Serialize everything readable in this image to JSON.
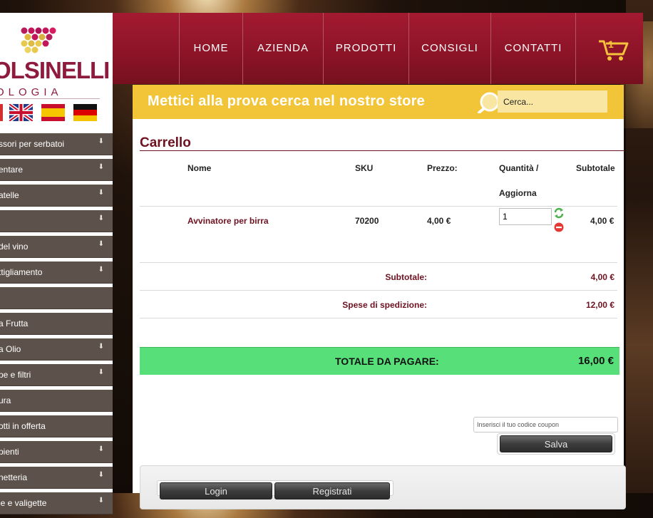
{
  "brand": {
    "name": "OLSINELLI",
    "subtitle": "OLOGIA"
  },
  "languages": [
    "Italiano",
    "English",
    "Español",
    "Deutsch"
  ],
  "sidebar": {
    "items": [
      {
        "label": "ssori per serbatoi",
        "has_children": true
      },
      {
        "label": "entare",
        "has_children": true
      },
      {
        "label": "atelle",
        "has_children": true
      },
      {
        "label": "",
        "has_children": true
      },
      {
        "label": "del vino",
        "has_children": true
      },
      {
        "label": "ttigliamento",
        "has_children": true
      },
      {
        "label": "",
        "has_children": false
      },
      {
        "label": "a Frutta",
        "has_children": false
      },
      {
        "label": "a Olio",
        "has_children": true
      },
      {
        "label": "pe e filtri",
        "has_children": true
      },
      {
        "label": "ura",
        "has_children": false
      },
      {
        "label": "otti in offerta",
        "has_children": false
      },
      {
        "label": "pienti",
        "has_children": true
      },
      {
        "label": "netteria",
        "has_children": true
      },
      {
        "label": "le e valigette",
        "has_children": true
      }
    ]
  },
  "nav": {
    "items": [
      "HOME",
      "AZIENDA",
      "PRODOTTI",
      "CONSIGLI",
      "CONTATTI"
    ],
    "cart_count": "1",
    "cart_icon": "shopping-cart-icon"
  },
  "search": {
    "title": "Mettici alla prova cerca nel nostro store",
    "placeholder": "Cerca..."
  },
  "cart": {
    "title": "Carrello",
    "headers": {
      "name": "Nome",
      "sku": "SKU",
      "price": "Prezzo:",
      "qty_line1": "Quantità /",
      "qty_line2": "Aggiorna",
      "subtotal": "Subtotale"
    },
    "items": [
      {
        "name": "Avvinatore per birra",
        "sku": "70200",
        "price": "4,00 €",
        "quantity": "1",
        "subtotal": "4,00 €"
      }
    ],
    "summary": {
      "subtotal_label": "Subtotale:",
      "subtotal_value": "4,00 €",
      "shipping_label": "Spese di spedizione:",
      "shipping_value": "12,00 €",
      "total_label": "TOTALE DA PAGARE:",
      "total_value": "16,00 €"
    },
    "coupon_placeholder": "Inserisci il tuo codice coupon",
    "save_label": "Salva"
  },
  "account": {
    "login_label": "Login",
    "register_label": "Registrati"
  },
  "colors": {
    "nav_bg": "#8d1427",
    "search_band": "#f2c437",
    "total_bar": "#57df7a",
    "sidebar_item": "#5d524b",
    "brand_text": "#6e1120"
  }
}
